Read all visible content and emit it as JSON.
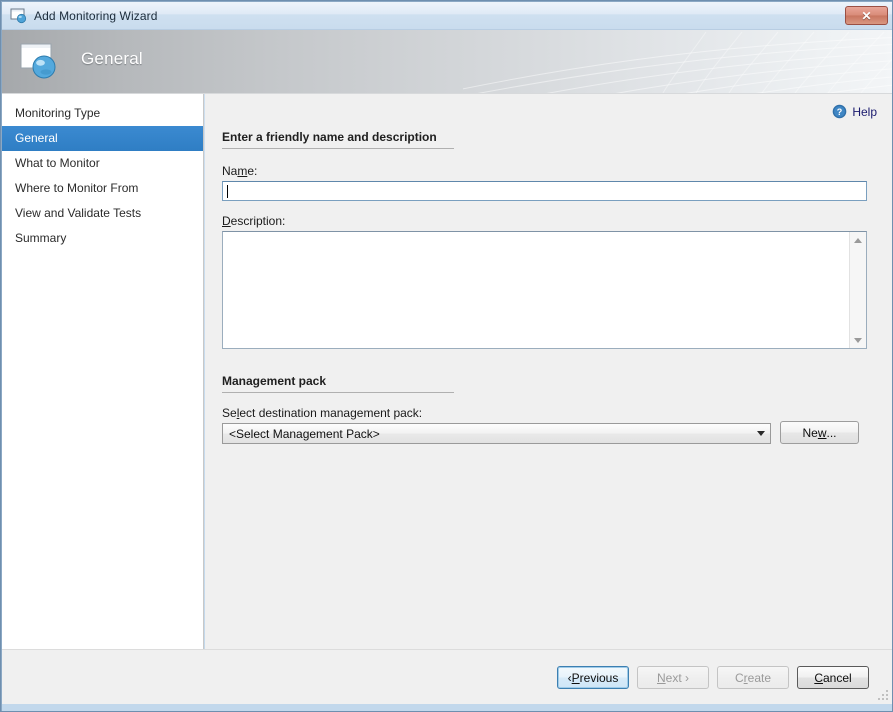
{
  "window": {
    "title": "Add Monitoring Wizard",
    "title_icon": "monitor-sphere-icon",
    "close_label": "✕"
  },
  "header": {
    "title": "General",
    "icon": "monitor-sphere-icon"
  },
  "sidebar": {
    "items": [
      {
        "label": "Monitoring Type",
        "selected": false
      },
      {
        "label": "General",
        "selected": true
      },
      {
        "label": "What to Monitor",
        "selected": false
      },
      {
        "label": "Where to Monitor From",
        "selected": false
      },
      {
        "label": "View and Validate Tests",
        "selected": false
      },
      {
        "label": "Summary",
        "selected": false
      }
    ]
  },
  "help": {
    "label": "Help",
    "icon": "question-mark-icon"
  },
  "main": {
    "friendly_section": {
      "heading": "Enter a friendly name and description",
      "name_label_pre": "Na",
      "name_label_acc": "m",
      "name_label_post": "e:",
      "name_value": "",
      "name_placeholder": "",
      "desc_label_acc": "D",
      "desc_label_post": "escription:",
      "desc_value": "",
      "desc_placeholder": ""
    },
    "mp_section": {
      "heading": "Management pack",
      "select_label_pre": "Se",
      "select_label_acc": "l",
      "select_label_post": "ect destination management pack:",
      "combo_value": "<Select Management Pack>",
      "new_button_pre": "Ne",
      "new_button_acc": "w",
      "new_button_post": "..."
    }
  },
  "footer": {
    "buttons": [
      {
        "pre": "‹ ",
        "acc": "P",
        "post": "revious",
        "state": "focused"
      },
      {
        "pre": "",
        "acc": "N",
        "post": "ext ›",
        "state": "disabled"
      },
      {
        "pre": "C",
        "acc": "r",
        "post": "eate",
        "state": "disabled"
      },
      {
        "pre": "",
        "acc": "C",
        "post": "ancel",
        "state": "hover"
      }
    ]
  },
  "colors": {
    "accent_selected": "#2f7ec4",
    "close_button": "#c87560",
    "help_link": "#1a1a6e",
    "focus_border": "#3c7fb1"
  }
}
